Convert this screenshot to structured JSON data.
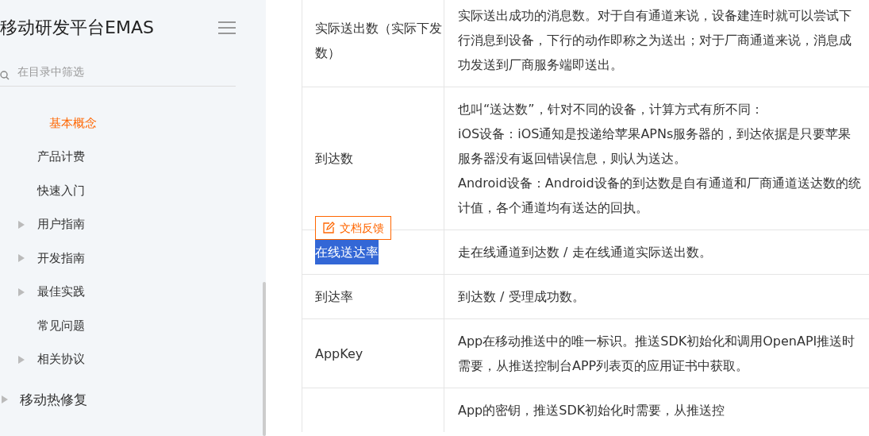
{
  "sidebar": {
    "title": "移动研发平台EMAS",
    "search": {
      "placeholder": "在目录中筛选"
    },
    "section_items": [
      {
        "label": "基本概念",
        "selected": true,
        "expandable": false
      },
      {
        "label": "产品计费",
        "selected": false,
        "expandable": false
      },
      {
        "label": "快速入门",
        "selected": false,
        "expandable": false
      },
      {
        "label": "用户指南",
        "selected": false,
        "expandable": true
      },
      {
        "label": "开发指南",
        "selected": false,
        "expandable": true
      },
      {
        "label": "最佳实践",
        "selected": false,
        "expandable": true
      },
      {
        "label": "常见问题",
        "selected": false,
        "expandable": false
      },
      {
        "label": "相关协议",
        "selected": false,
        "expandable": true
      }
    ],
    "sections": [
      {
        "label": "移动热修复",
        "expandable": true
      }
    ]
  },
  "feedback_button": "文档反馈",
  "table": {
    "rows": [
      {
        "term": "实际送出数（实际下发数）",
        "highlighted": false,
        "description": "实际送出成功的消息数。对于自有通道来说，设备建连时就可以尝试下行消息到设备，下行的动作即称之为送出；对于厂商通道来说，消息成功发送到厂商服务端即送出。"
      },
      {
        "term": "到达数",
        "highlighted": false,
        "description": "也叫“送达数”，针对不同的设备，计算方式有所不同：\niOS设备：iOS通知是投递给苹果APNs服务器的，到达依据是只要苹果服务器没有返回错误信息，则认为送达。\nAndroid设备：Android设备的到达数是自有通道和厂商通道送达数的统计值，各个通道均有送达的回执。"
      },
      {
        "term": "在线送达率",
        "highlighted": true,
        "description": "走在线通道到达数 / 走在线通道实际送出数。"
      },
      {
        "term": "到达率",
        "highlighted": false,
        "description": "到达数 / 受理成功数。"
      },
      {
        "term": "AppKey",
        "highlighted": false,
        "description": "App在移动推送中的唯一标识。推送SDK初始化和调用OpenAPI推送时需要，从推送控制台APP列表页的应用证书中获取。"
      },
      {
        "description": "App的密钥，推送SDK初始化时需要，从推送控"
      }
    ]
  }
}
